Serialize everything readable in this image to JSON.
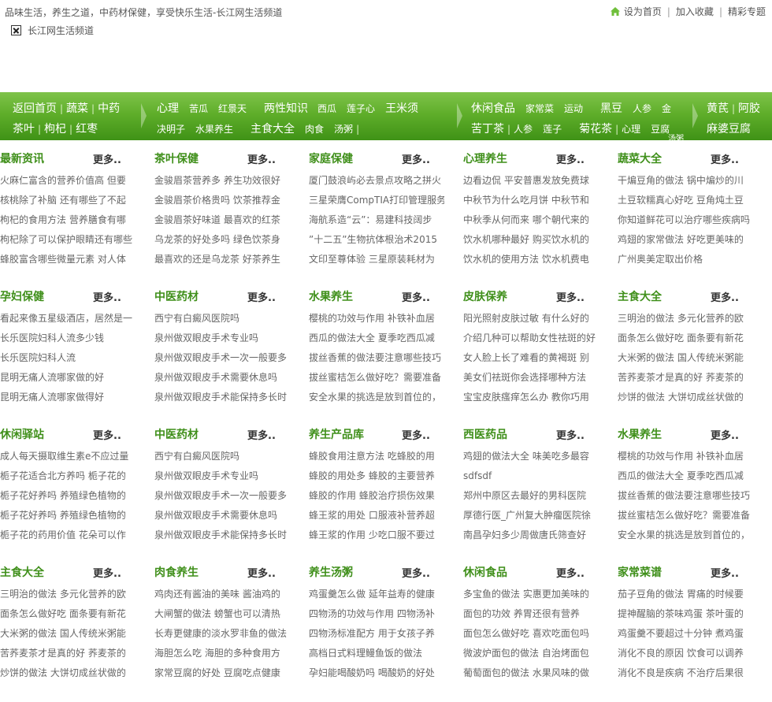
{
  "header": {
    "slogan": "品味生活，养生之道，中药材保健，享受快乐生活-长江网生活频道",
    "links": [
      "设为首页",
      "加入收藏",
      "精彩专题"
    ],
    "link_separator": "|",
    "logo_alt": "长江网生活频道"
  },
  "nav": {
    "separator": "|",
    "blocks": [
      {
        "rows": [
          [
            "返回首页",
            "|",
            "蔬菜",
            "|",
            "中药"
          ],
          [
            "茶叶",
            "|",
            "枸杞",
            "|",
            "红枣"
          ]
        ]
      },
      {
        "rows": [
          [
            "心理",
            "苦瓜",
            "红景天",
            "两性知识",
            "西瓜",
            "莲子心",
            "王米须"
          ],
          [
            "决明子",
            "水果养生",
            "主食大全",
            "肉食",
            "汤粥",
            "|"
          ]
        ]
      },
      {
        "rows": [
          [
            "休闲食品",
            "家常菜",
            "运动",
            "黑豆",
            "人参",
            "金"
          ],
          [
            "苦丁茶",
            "|",
            "人参",
            "莲子",
            "菊花茶",
            "|",
            "心理",
            "豆腐"
          ],
          [
            "汤粥"
          ]
        ]
      },
      {
        "rows": [
          [
            "黄芪",
            "|",
            "阿胶"
          ],
          [
            "麻婆豆腐"
          ]
        ]
      }
    ]
  },
  "sections": [
    {
      "title": "最新资讯",
      "more": "更多..",
      "items": [
        "火麻仁富含的营养价值高 但要",
        "核桃除了补脑 还有哪些了不起",
        "枸杞的食用方法 营养膳食有哪",
        "枸杞除了可以保护眼睛还有哪些",
        "蜂胶富含哪些微量元素 对人体"
      ]
    },
    {
      "title": "茶叶保健",
      "more": "更多..",
      "items": [
        "金骏眉茶营养多 养生功效很好",
        "金骏眉茶价格贵吗 饮茶推荐金",
        "金骏眉茶好味道 最喜欢的红茶",
        "乌龙茶的好处多吗 绿色饮茶身",
        "最喜欢的还是乌龙茶 好茶养生"
      ]
    },
    {
      "title": "家庭保健",
      "more": "更多..",
      "items": [
        "厦门鼓浪屿必去景点攻略之拼火",
        "三星荣膺CompTIA打印管理服务",
        "海航系造“云”：易建科技阔步",
        "”十二五”生物抗体根治术2015",
        "文印至尊体验 三星原装耗材为"
      ]
    },
    {
      "title": "心理养生",
      "more": "更多..",
      "items": [
        "边看边侃 平安普惠发放免费球",
        "中秋节为什么吃月饼 中秋节和",
        "中秋季从何而来 哪个朝代来的",
        "饮水机哪种最好 购买饮水机的",
        "饮水机的使用方法 饮水机费电"
      ]
    },
    {
      "title": "蔬菜大全",
      "more": "更多..",
      "items": [
        "干煸豆角的做法 锅中煸炒的川",
        "土豆软糯真心好吃 豆角炖土豆",
        "你知道鲜花可以治疗哪些疾病吗",
        "鸡翅的家常做法 好吃更美味的",
        "广州奥美定取出价格"
      ]
    },
    {
      "title": "孕妇保健",
      "more": "更多..",
      "items": [
        "看起来像五星级酒店，居然是一",
        "长乐医院妇科人流多少钱",
        "长乐医院妇科人流",
        "昆明无痛人流哪家做的好",
        "昆明无痛人流哪家做得好"
      ]
    },
    {
      "title": "中医药材",
      "more": "更多..",
      "items": [
        "西宁有白癜风医院吗",
        "泉州做双眼皮手术专业吗",
        "泉州做双眼皮手术一次一般要多",
        "泉州做双眼皮手术需要休息吗",
        "泉州做双眼皮手术能保持多长时"
      ]
    },
    {
      "title": "水果养生",
      "more": "更多..",
      "items": [
        "樱桃的功效与作用 补铁补血居",
        "西瓜的做法大全 夏季吃西瓜减",
        "拔丝香蕉的做法要注意哪些技巧",
        "拔丝蜜桔怎么做好吃？需要准备",
        "安全水果的挑选是放到首位的，"
      ]
    },
    {
      "title": "皮肤保养",
      "more": "更多..",
      "items": [
        "阳光照射皮肤过敏 有什么好的",
        "介绍几种可以帮助女性祛斑的好",
        "女人脸上长了难看的黄褐斑 别",
        "美女们祛斑你会选择哪种方法",
        "宝宝皮肤瘙痒怎么办 教你巧用"
      ]
    },
    {
      "title": "主食大全",
      "more": "更多..",
      "items": [
        "三明治的做法 多元化营养的欧",
        "面条怎么做好吃 面条要有新花",
        "大米粥的做法 国人传统米粥能",
        "苦荞麦茶才是真的好 荞麦茶的",
        "炒饼的做法 大饼切成丝状做的"
      ]
    },
    {
      "title": "休闲驿站",
      "more": "更多..",
      "items": [
        "成人每天摄取维生素e不应过量",
        "栀子花适合北方养吗 栀子花的",
        "栀子花好养吗 养殖绿色植物的",
        "栀子花好养吗 养殖绿色植物的",
        "栀子花的药用价值 花朵可以作"
      ]
    },
    {
      "title": "中医药材",
      "more": "更多..",
      "items": [
        "西宁有白癜风医院吗",
        "泉州做双眼皮手术专业吗",
        "泉州做双眼皮手术一次一般要多",
        "泉州做双眼皮手术需要休息吗",
        "泉州做双眼皮手术能保持多长时"
      ]
    },
    {
      "title": "养生产品库",
      "more": "更多..",
      "items": [
        "蜂胶食用注意方法 吃蜂胶的用",
        "蜂胶的用处多 蜂胶的主要营养",
        "蜂胶的作用 蜂胶治疗损伤效果",
        "蜂王浆的用处 口服液补营养超",
        "蜂王浆的作用 少吃口服不要过"
      ]
    },
    {
      "title": "西医药品",
      "more": "更多..",
      "items": [
        "鸡翅的做法大全 味美吃多最容",
        "sdfsdf",
        "郑州中原区去最好的男科医院",
        "厚德行医_广州复大肿瘤医院徐",
        "南昌孕妇多少周做唐氏筛查好"
      ]
    },
    {
      "title": "水果养生",
      "more": "更多..",
      "items": [
        "樱桃的功效与作用 补铁补血居",
        "西瓜的做法大全 夏季吃西瓜减",
        "拔丝香蕉的做法要注意哪些技巧",
        "拔丝蜜桔怎么做好吃？需要准备",
        "安全水果的挑选是放到首位的，"
      ]
    },
    {
      "title": "主食大全",
      "more": "更多..",
      "items": [
        "三明治的做法 多元化营养的欧",
        "面条怎么做好吃 面条要有新花",
        "大米粥的做法 国人传统米粥能",
        "苦荞麦茶才是真的好 荞麦茶的",
        "炒饼的做法 大饼切成丝状做的"
      ]
    },
    {
      "title": "肉食养生",
      "more": "更多..",
      "items": [
        "鸡肉还有酱油的美味 酱油鸡的",
        "大闸蟹的做法 螃蟹也可以清热",
        "长寿更健康的淡水罗非鱼的做法",
        "海胆怎么吃 海胆的多种食用方",
        "家常豆腐的好处 豆腐吃点健康"
      ]
    },
    {
      "title": "养生汤粥",
      "more": "更多..",
      "items": [
        "鸡蛋羹怎么做 延年益寿的健康",
        "四物汤的功效与作用 四物汤补",
        "四物汤标准配方 用于女孩子养",
        "高档日式料理鳗鱼饭的做法",
        "孕妇能喝酸奶吗 喝酸奶的好处"
      ]
    },
    {
      "title": "休闲食品",
      "more": "更多..",
      "items": [
        "多宝鱼的做法 实惠更加美味的",
        "面包的功效 养胃还很有营养",
        "面包怎么做好吃 喜欢吃面包吗",
        "微波炉面包的做法 自治烤面包",
        "葡萄面包的做法 水果风味的做"
      ]
    },
    {
      "title": "家常菜谱",
      "more": "更多..",
      "items": [
        "茄子豆角的做法 胃痛的时候要",
        "提神醒脑的茶味鸡蛋 茶叶蛋的",
        "鸡蛋羹不要超过十分钟 煮鸡蛋",
        "消化不良的原因 饮食可以调养",
        "消化不良是疾病 不治疗后果很"
      ]
    }
  ]
}
